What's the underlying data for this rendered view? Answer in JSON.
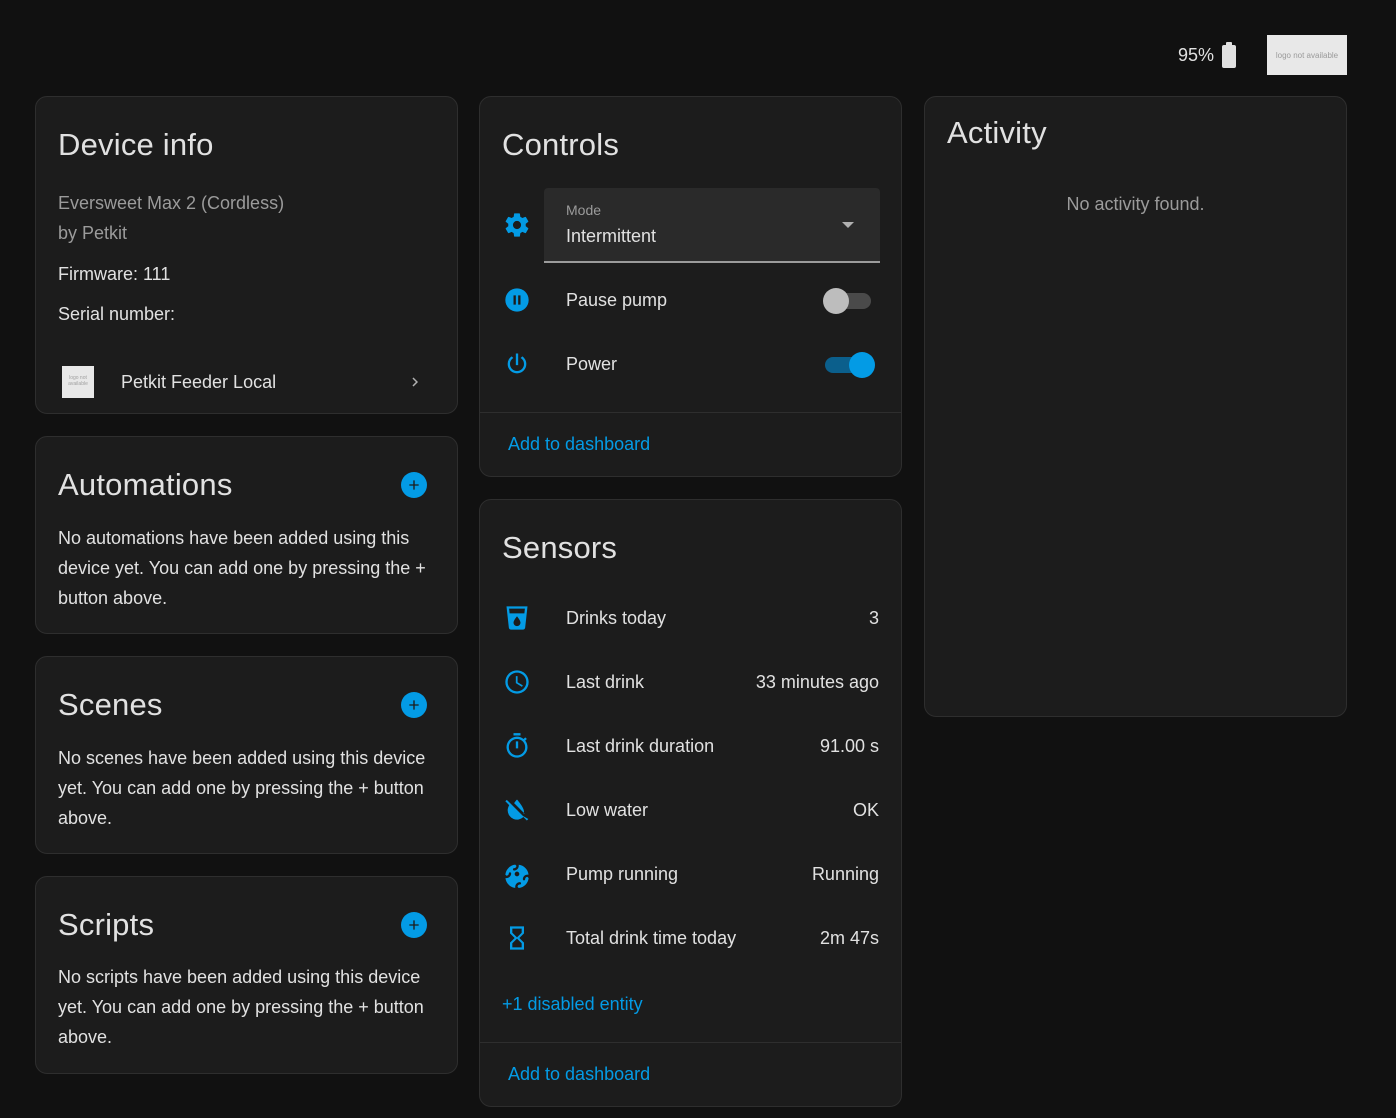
{
  "topbar": {
    "battery_percent": "95%",
    "logo_text": "logo not available"
  },
  "device_info": {
    "title": "Device info",
    "model": "Eversweet Max 2 (Cordless)",
    "manufacturer": "by Petkit",
    "firmware": "Firmware: 111",
    "serial": "Serial number:",
    "integration": {
      "logo_text": "logo not available",
      "name": "Petkit Feeder Local"
    }
  },
  "automations": {
    "title": "Automations",
    "message": "No automations have been added using this device yet. You can add one by pressing the + button above."
  },
  "scenes": {
    "title": "Scenes",
    "message": "No scenes have been added using this device yet. You can add one by pressing the + button above."
  },
  "scripts": {
    "title": "Scripts",
    "message": "No scripts have been added using this device yet. You can add one by pressing the + button above."
  },
  "controls": {
    "title": "Controls",
    "mode": {
      "label": "Mode",
      "value": "Intermittent",
      "icon": "cog-icon"
    },
    "pause_pump": {
      "label": "Pause pump",
      "icon": "pause-circle-icon",
      "state": "off"
    },
    "power": {
      "label": "Power",
      "icon": "power-icon",
      "state": "on"
    },
    "add_to_dashboard": "Add to dashboard"
  },
  "sensors": {
    "title": "Sensors",
    "items": [
      {
        "label": "Drinks today",
        "value": "3",
        "icon": "cup-water-icon"
      },
      {
        "label": "Last drink",
        "value": "33 minutes ago",
        "icon": "clock-icon"
      },
      {
        "label": "Last drink duration",
        "value": "91.00 s",
        "icon": "timer-icon"
      },
      {
        "label": "Low water",
        "value": "OK",
        "icon": "water-off-icon"
      },
      {
        "label": "Pump running",
        "value": "Running",
        "icon": "pump-icon"
      },
      {
        "label": "Total drink time today",
        "value": "2m 47s",
        "icon": "hourglass-icon"
      }
    ],
    "disabled_entities": "+1 disabled entity",
    "add_to_dashboard": "Add to dashboard"
  },
  "activity": {
    "title": "Activity",
    "empty_message": "No activity found."
  },
  "colors": {
    "accent": "#039be5",
    "background": "#111111",
    "card": "#1c1c1c"
  }
}
